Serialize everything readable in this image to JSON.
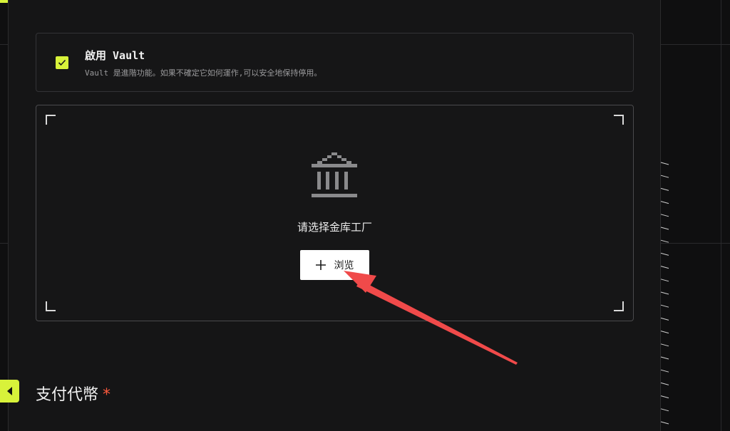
{
  "vault": {
    "title": "啟用 Vault",
    "description": "Vault 是進階功能。如果不確定它如何運作,可以安全地保持停用。",
    "enabled": true
  },
  "factory": {
    "prompt": "请选择金库工厂",
    "browse_label": "浏览",
    "icon": "bank-icon"
  },
  "payment": {
    "heading": "支付代幣",
    "required_mark": "*"
  },
  "colors": {
    "accent": "#d8f23a",
    "required": "#ff5a3d",
    "arrow": "#f04a4a"
  }
}
